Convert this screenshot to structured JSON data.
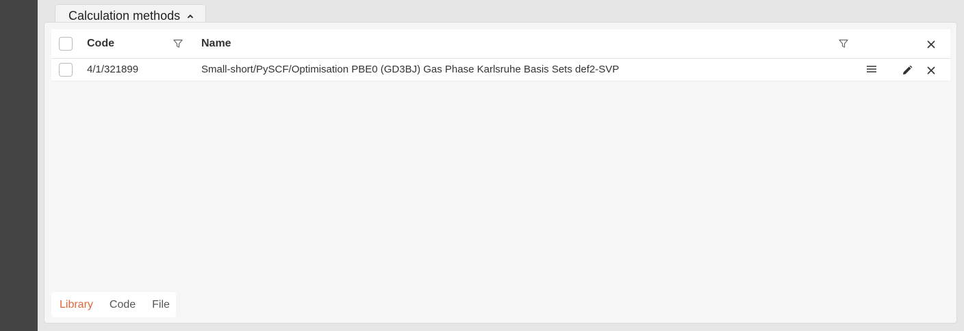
{
  "section": {
    "title": "Calculation methods",
    "expanded": true
  },
  "table": {
    "columns": {
      "code": "Code",
      "name": "Name"
    },
    "rows": [
      {
        "code": "4/1/321899",
        "name": "Small-short/PySCF/Optimisation PBE0 (GD3BJ) Gas Phase Karlsruhe Basis Sets def2-SVP"
      }
    ]
  },
  "bottom_tabs": {
    "items": [
      "Library",
      "Code",
      "File"
    ],
    "active": "Library"
  },
  "colors": {
    "accent": "#e0673a",
    "rail": "#444444",
    "panel": "#f6f6f6"
  },
  "icons": [
    "chevron-up-icon",
    "filter-icon",
    "close-icon",
    "menu-icon",
    "edit-icon"
  ]
}
